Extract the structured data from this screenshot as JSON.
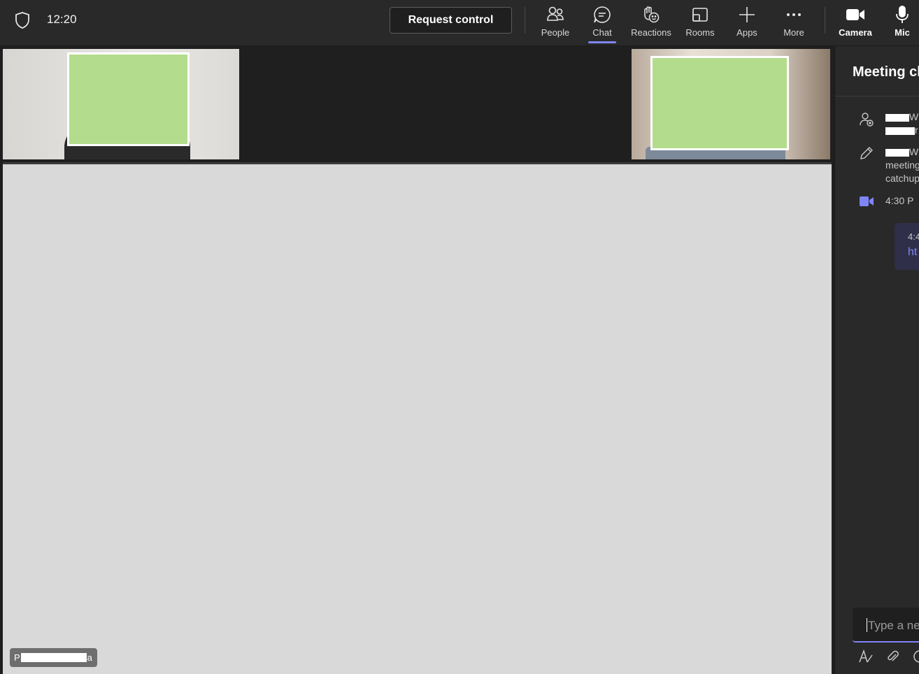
{
  "status": {
    "clock": "12:20"
  },
  "toolbar": {
    "request_control": "Request control",
    "tools": [
      {
        "label": "People",
        "icon": "people-icon"
      },
      {
        "label": "Chat",
        "icon": "chat-icon",
        "active": true
      },
      {
        "label": "Reactions",
        "icon": "reactions-icon"
      },
      {
        "label": "Rooms",
        "icon": "rooms-icon"
      },
      {
        "label": "Apps",
        "icon": "plus-icon"
      },
      {
        "label": "More",
        "icon": "more-icon"
      }
    ],
    "camera": "Camera",
    "mic": "Mic"
  },
  "stage": {
    "presenter_first": "P",
    "presenter_last": "a"
  },
  "chat_panel": {
    "title": "Meeting ch",
    "events": [
      {
        "icon": "person-add-icon",
        "lines": [
          "W",
          "r"
        ]
      },
      {
        "icon": "pencil-icon",
        "lines": [
          "W",
          "meeting",
          "catchup"
        ]
      },
      {
        "icon": "video-icon",
        "lines": [
          "4:30 P"
        ]
      }
    ],
    "message": {
      "time": "4:4",
      "link": "ht"
    },
    "compose_placeholder": "Type a new"
  },
  "colors": {
    "accent": "#7f85f5",
    "blur": "#b3dd8c",
    "stage": "#d9d9d9",
    "bar": "#292929"
  }
}
